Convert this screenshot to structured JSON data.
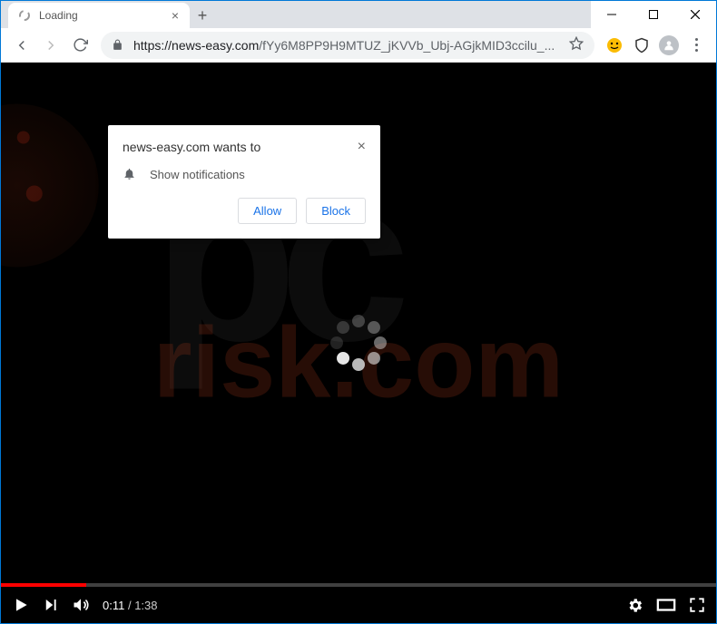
{
  "tab": {
    "title": "Loading"
  },
  "url": {
    "scheme": "https://",
    "host": "news-easy.com",
    "path": "/fYy6M8PP9H9MTUZ_jKVVb_Ubj-AGjkMID3ccilu_..."
  },
  "permission": {
    "origin": "news-easy.com wants to",
    "label": "Show notifications",
    "allow": "Allow",
    "block": "Block"
  },
  "video": {
    "current": "0:11",
    "sep": " / ",
    "duration": "1:38",
    "progress_pct": 11.9
  },
  "watermark": {
    "top": "pc",
    "bottom": "risk.com"
  }
}
